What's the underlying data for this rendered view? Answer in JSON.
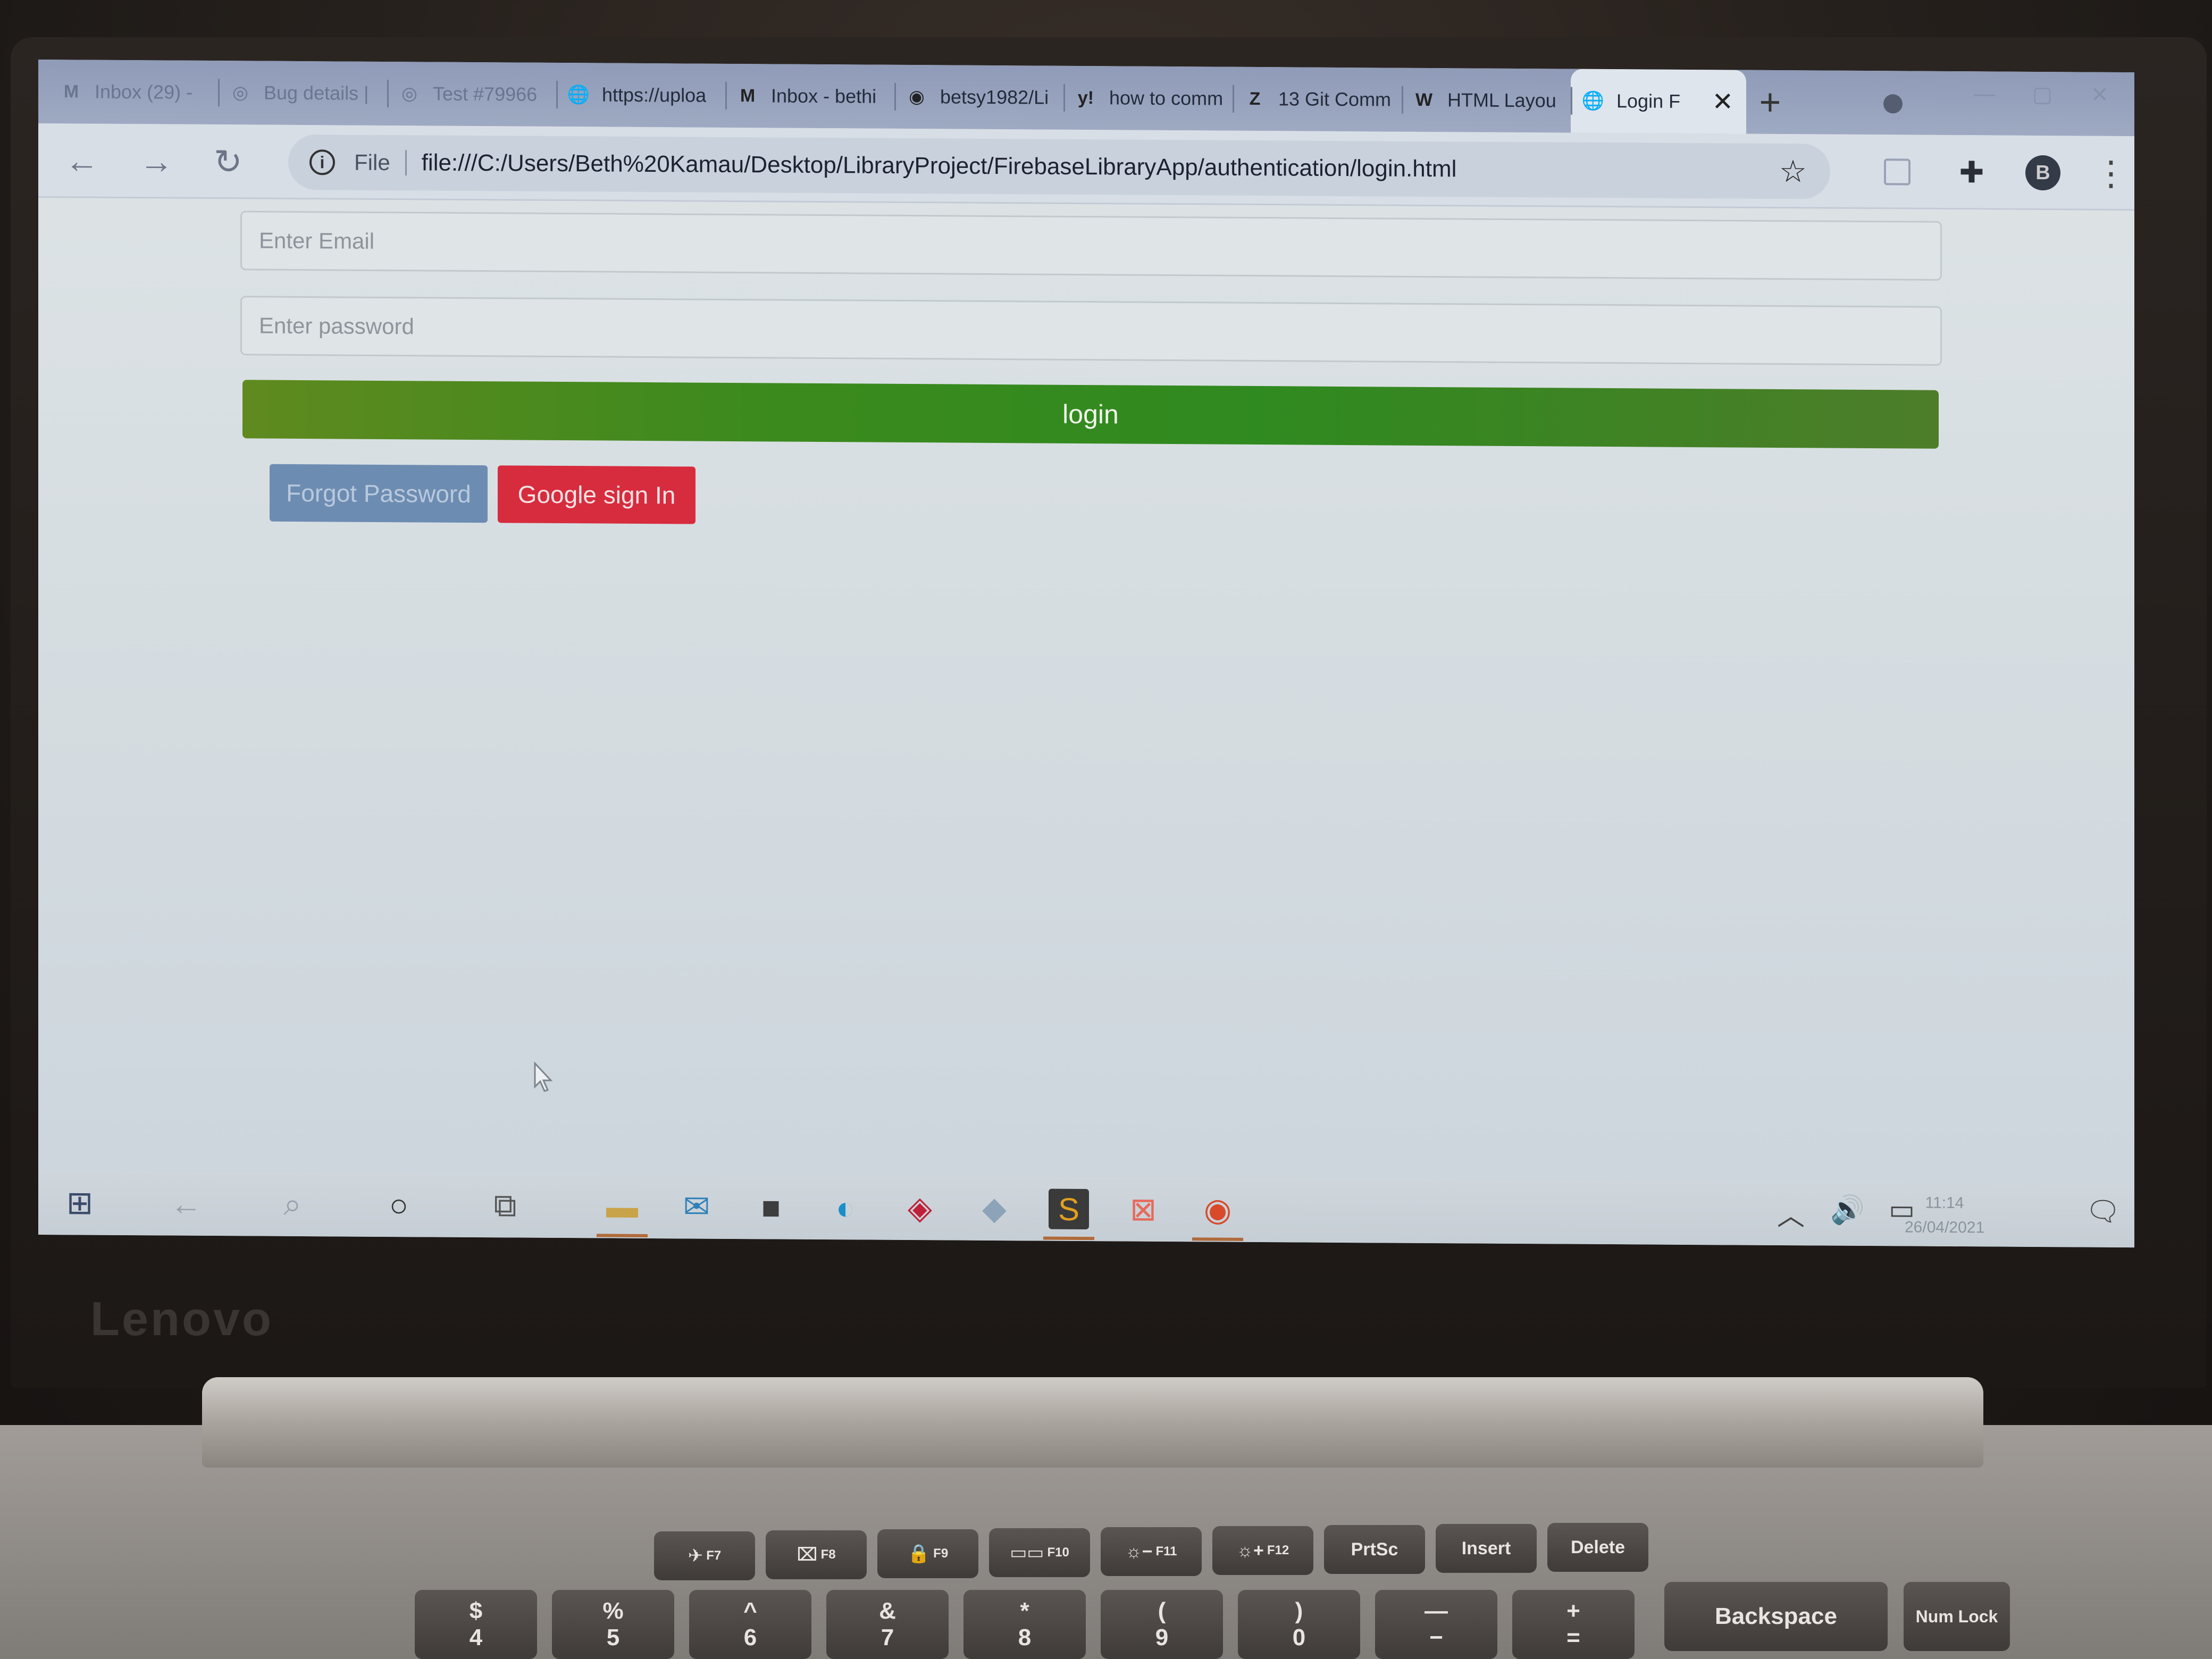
{
  "browser": {
    "tabs": [
      {
        "icon": "M",
        "title": "Inbox (29) -",
        "faded": true
      },
      {
        "icon": "◎",
        "title": "Bug details |",
        "faded": true
      },
      {
        "icon": "◎",
        "title": "Test #79966",
        "faded": true
      },
      {
        "icon": "🌐",
        "title": "https://uploa",
        "faded": false
      },
      {
        "icon": "M",
        "title": "Inbox - bethi",
        "faded": false
      },
      {
        "icon": "◉",
        "title": "betsy1982/Li",
        "faded": false
      },
      {
        "icon": "y!",
        "title": "how to comm",
        "faded": false
      },
      {
        "icon": "Z",
        "title": "13 Git Comm",
        "faded": false
      },
      {
        "icon": "W",
        "title": "HTML Layou",
        "faded": false
      },
      {
        "icon": "🌐",
        "title": "Login F",
        "faded": false,
        "active": true
      }
    ],
    "new_tab_label": "+",
    "address_bar": {
      "scheme_label": "File",
      "url": "file:///C:/Users/Beth%20Kamau/Desktop/LibraryProject/FirebaseLibraryApp/authentication/login.html"
    }
  },
  "login_form": {
    "email_placeholder": "Enter Email",
    "password_placeholder": "Enter password",
    "login_label": "login",
    "forgot_password_label": "Forgot Password",
    "google_sign_in_label": "Google sign In",
    "colors": {
      "login": "#2f8a1f",
      "forgot": "#6d8cb2",
      "google": "#d72c3e"
    }
  },
  "taskbar": {
    "clock_time": "11:14",
    "clock_date": "26/04/2021"
  },
  "laptop": {
    "brand": "Lenovo",
    "fn_keys": [
      {
        "label": "✈",
        "fn": "F7"
      },
      {
        "label": "⌧",
        "fn": "F8"
      },
      {
        "label": "🔒",
        "fn": "F9"
      },
      {
        "label": "▭▭",
        "fn": "F10"
      },
      {
        "label": "☼−",
        "fn": "F11"
      },
      {
        "label": "☼+",
        "fn": "F12"
      },
      {
        "label": "PrtSc",
        "fn": ""
      },
      {
        "label": "Insert",
        "fn": ""
      },
      {
        "label": "Delete",
        "fn": ""
      }
    ],
    "num_keys": [
      "4",
      "5",
      "6",
      "7",
      "8",
      "9",
      "0",
      "−",
      "="
    ],
    "num_shift": [
      "$",
      "%",
      "^",
      "&",
      "*",
      "(",
      ")",
      "—",
      "+"
    ],
    "backspace_label": "Backspace",
    "numlock_label": "Num Lock"
  }
}
